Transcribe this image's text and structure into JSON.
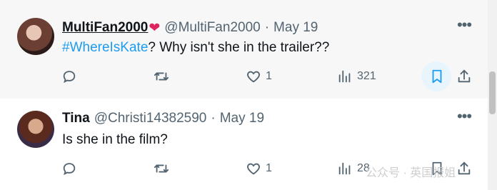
{
  "tweets": [
    {
      "name": "MultiFan2000",
      "badge": "❤",
      "handle": "@MultiFan2000",
      "separator": "·",
      "date": "May 19",
      "hashtag": "#WhereIsKate",
      "text": "? Why isn't she in the trailer??",
      "more": "•••",
      "likes": "1",
      "views": "321",
      "bookmarked": true
    },
    {
      "name": "Tina",
      "handle": "@Christi14382590",
      "separator": "·",
      "date": "May 19",
      "text": "Is she in the film?",
      "more": "•••",
      "likes": "1",
      "views": "28"
    }
  ],
  "watermark": "公众号 · 英国报姐",
  "colors": {
    "accent": "#1d9bf0",
    "muted": "#536471",
    "heart": "#e0245e"
  }
}
